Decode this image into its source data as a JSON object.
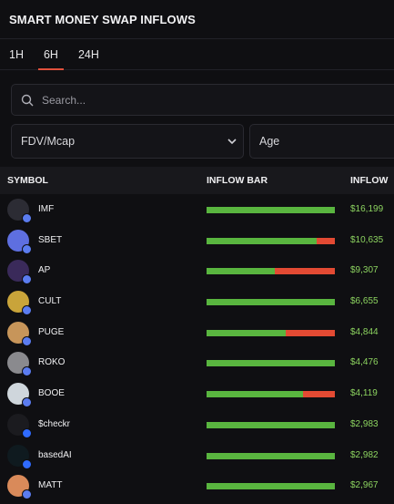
{
  "header": {
    "title": "SMART MONEY SWAP INFLOWS"
  },
  "tabs": [
    {
      "label": "1H",
      "active": false
    },
    {
      "label": "6H",
      "active": true
    },
    {
      "label": "24H",
      "active": false
    }
  ],
  "search": {
    "placeholder": "Search..."
  },
  "filters": {
    "fdv_label": "FDV/Mcap",
    "age_label": "Age"
  },
  "table": {
    "columns": {
      "symbol": "SYMBOL",
      "bar": "INFLOW BAR",
      "inflow": "INFLOW"
    },
    "rows": [
      {
        "symbol": "IMF",
        "buy_fraction": 1.0,
        "inflow": "$16,199",
        "chain": "ethereum",
        "avatar": "#2c2c34"
      },
      {
        "symbol": "SBET",
        "buy_fraction": 0.86,
        "inflow": "$10,635",
        "chain": "ethereum",
        "avatar": "#5e6fe0"
      },
      {
        "symbol": "AP",
        "buy_fraction": 0.53,
        "inflow": "$9,307",
        "chain": "ethereum",
        "avatar": "#3a2a5a"
      },
      {
        "symbol": "CULT",
        "buy_fraction": 1.0,
        "inflow": "$6,655",
        "chain": "ethereum",
        "avatar": "#c9a43a"
      },
      {
        "symbol": "PUGE",
        "buy_fraction": 0.62,
        "inflow": "$4,844",
        "chain": "ethereum",
        "avatar": "#c7955a"
      },
      {
        "symbol": "ROKO",
        "buy_fraction": 1.0,
        "inflow": "$4,476",
        "chain": "ethereum",
        "avatar": "#8a8a8e"
      },
      {
        "symbol": "BOOE",
        "buy_fraction": 0.75,
        "inflow": "$4,119",
        "chain": "ethereum",
        "avatar": "#cfd6dc"
      },
      {
        "symbol": "$checkr",
        "buy_fraction": 1.0,
        "inflow": "$2,983",
        "chain": "base",
        "avatar": "#1b1b1f"
      },
      {
        "symbol": "basedAI",
        "buy_fraction": 1.0,
        "inflow": "$2,982",
        "chain": "base",
        "avatar": "#0f1a1f"
      },
      {
        "symbol": "MATT",
        "buy_fraction": 1.0,
        "inflow": "$2,967",
        "chain": "ethereum",
        "avatar": "#d98a5a"
      }
    ]
  },
  "colors": {
    "buy": "#59b53f",
    "sell": "#e34a33",
    "inflow_text": "#8dd460",
    "tab_indicator": "#e0503c"
  }
}
